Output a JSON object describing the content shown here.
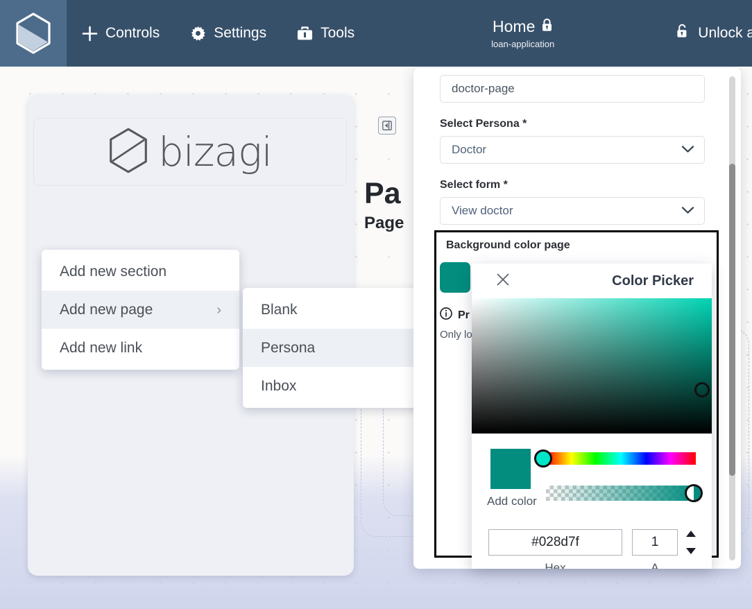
{
  "header": {
    "logo_icon": "bizagi-hexagon-logo-icon",
    "nav": [
      {
        "label": "Controls",
        "icon": "plus-icon"
      },
      {
        "label": "Settings",
        "icon": "gear-icon"
      },
      {
        "label": "Tools",
        "icon": "toolbox-icon"
      }
    ],
    "center": {
      "title": "Home",
      "lock_icon": "lock-closed-icon",
      "subtitle": "loan-application"
    },
    "unlock": {
      "label": "Unlock a",
      "icon": "lock-open-icon"
    }
  },
  "left_panel": {
    "brand_name": "bizagi",
    "brand_icon": "bizagi-hexagon-logo-icon",
    "add_new_label": "Add new",
    "kebab_icon": "more-vertical-icon"
  },
  "menu_add_new": {
    "items": [
      {
        "label": "Add new section",
        "active": false,
        "has_submenu": false
      },
      {
        "label": "Add new page",
        "active": true,
        "has_submenu": true
      },
      {
        "label": "Add new link",
        "active": false,
        "has_submenu": false
      }
    ],
    "submenu_chevron": "›"
  },
  "menu_add_page": {
    "items": [
      {
        "label": "Blank",
        "active": false
      },
      {
        "label": "Persona",
        "active": true
      },
      {
        "label": "Inbox",
        "active": false
      }
    ]
  },
  "canvas": {
    "collapse_icon": "collapse-panel-icon",
    "heading": "Pa",
    "subheading": "Page"
  },
  "properties": {
    "page_name_value": "doctor-page",
    "persona_label": "Select Persona *",
    "persona_value": "Doctor",
    "form_label": "Select form *",
    "form_value": "View doctor",
    "chevron_down_icon": "chevron-down-icon"
  },
  "background_color_group": {
    "label": "Background color page",
    "swatch_color": "#028d7f",
    "preview_title": "Pr",
    "preview_info_icon": "info-circle-icon",
    "preview_subtext": "Only lo"
  },
  "color_picker": {
    "title": "Color Picker",
    "close_icon": "close-icon",
    "preview_color": "#028d7f",
    "add_color_label": "Add color",
    "hex_value": "#028d7f",
    "alpha_value": "1",
    "hex_caption": "Hex",
    "alpha_caption": "A",
    "stepper_up_icon": "triangle-up-icon",
    "stepper_down_icon": "triangle-down-icon"
  },
  "colors": {
    "header_bg": "#37506a",
    "logo_tile_bg": "#4d6c8c",
    "page_bg": "#c4cbe9",
    "panel_bg": "#eef0f5",
    "accent_teal": "#028d7f",
    "highlight_border": "#000000"
  }
}
